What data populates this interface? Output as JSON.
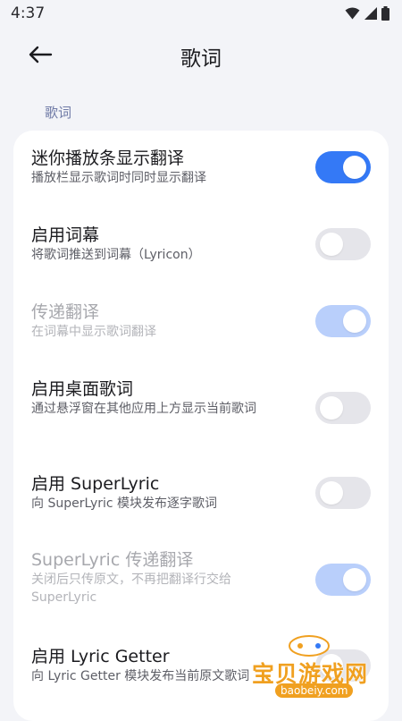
{
  "status_bar": {
    "time": "4:37",
    "icons": [
      "wifi-icon",
      "signal-icon",
      "battery-icon"
    ]
  },
  "app_bar": {
    "back_icon": "arrow-left-icon",
    "title": "歌词"
  },
  "section": {
    "header": "歌词"
  },
  "settings": [
    {
      "title": "迷你播放条显示翻译",
      "summary": "播放栏显示歌词时同时显示翻译",
      "switch_on": true,
      "enabled": true
    },
    {
      "title": "启用词幕",
      "summary": "将歌词推送到词幕（Lyricon）",
      "switch_on": false,
      "enabled": true
    },
    {
      "title": "传递翻译",
      "summary": "在词幕中显示歌词翻译",
      "switch_on": true,
      "enabled": false
    },
    {
      "title": "启用桌面歌词",
      "summary": "通过悬浮窗在其他应用上方显示当前歌词",
      "switch_on": false,
      "enabled": true
    },
    {
      "title": "启用 SuperLyric",
      "summary": "向 SuperLyric 模块发布逐字歌词",
      "switch_on": false,
      "enabled": true
    },
    {
      "title": "SuperLyric 传递翻译",
      "summary": "关闭后只传原文，不再把翻译行交给 SuperLyric",
      "switch_on": true,
      "enabled": false
    },
    {
      "title": "启用 Lyric Getter",
      "summary": "向 Lyric Getter 模块发布当前原文歌词",
      "switch_on": false,
      "enabled": true
    }
  ],
  "colors": {
    "accent": "#3479f6",
    "accent_disabled": "#b9cffb",
    "switch_off": "#e5e5ea",
    "section_header": "#6f7aa6",
    "background": "#f3f4f8"
  },
  "watermark": {
    "text": "宝贝游戏网",
    "url": "baobeiy.com"
  }
}
